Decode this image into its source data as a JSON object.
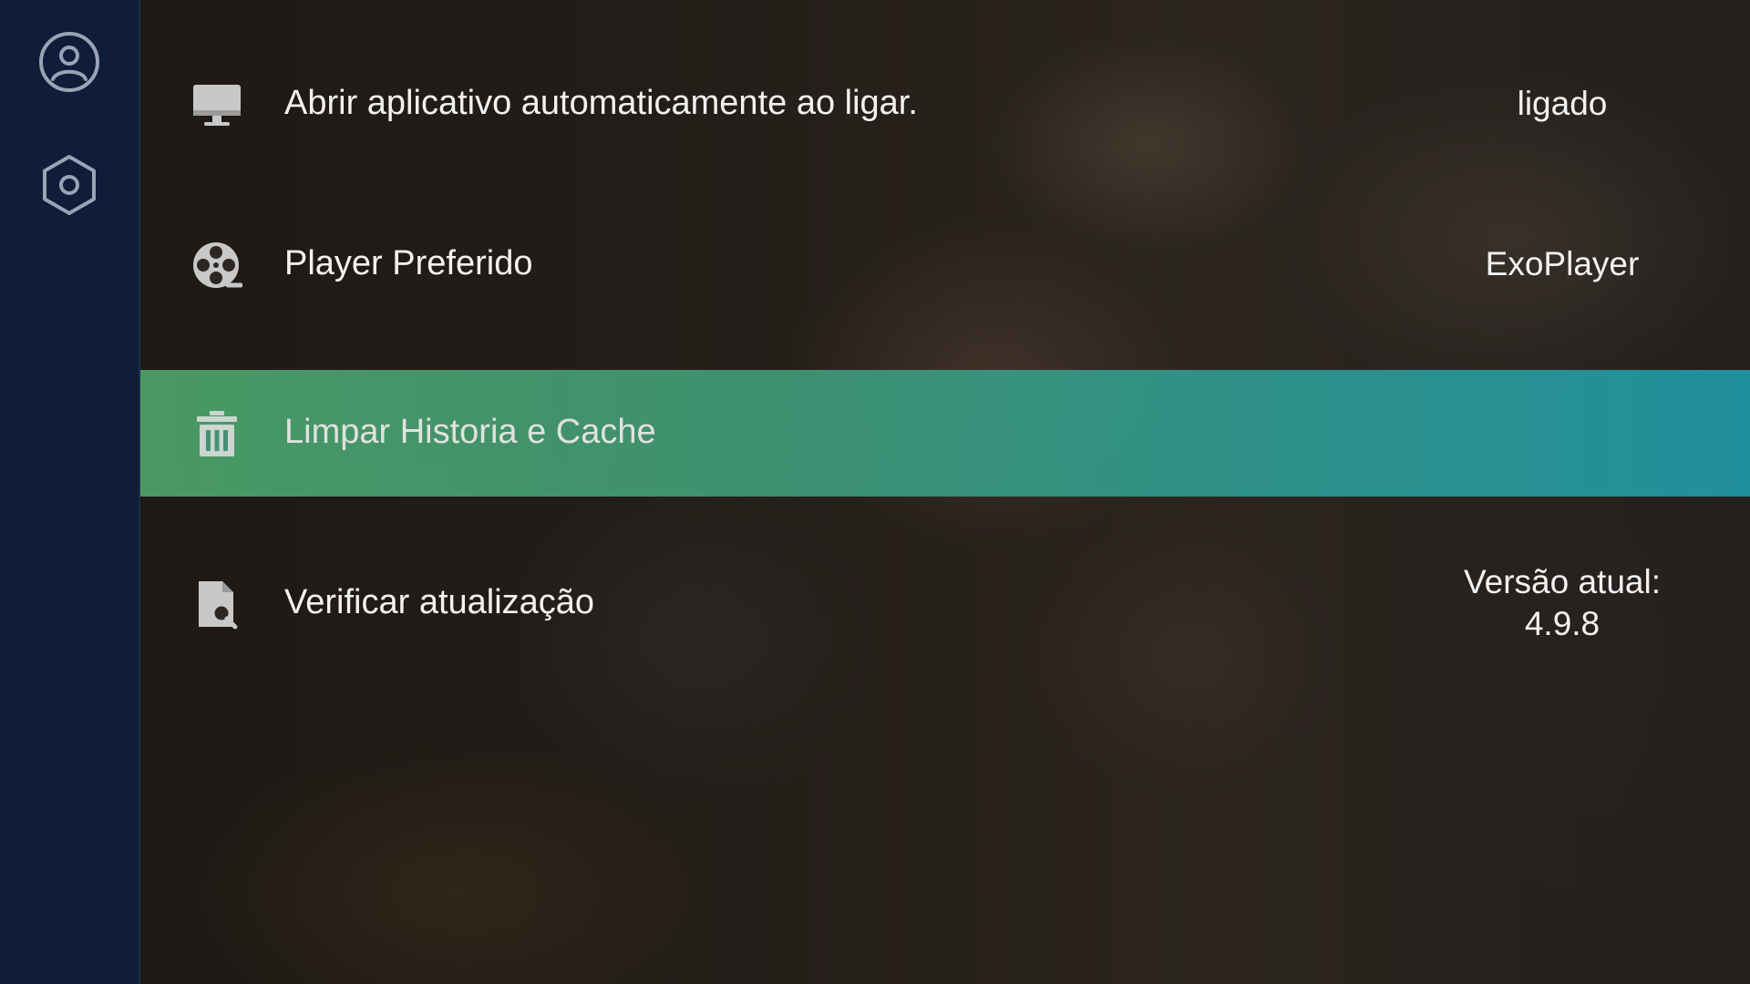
{
  "sidebar": {
    "items": [
      {
        "icon": "user-circle-icon"
      },
      {
        "icon": "settings-hexagon-icon"
      }
    ]
  },
  "settings": [
    {
      "icon": "monitor-icon",
      "label": "Abrir aplicativo automaticamente ao ligar.",
      "value": "ligado"
    },
    {
      "icon": "film-reel-icon",
      "label": "Player Preferido",
      "value": "ExoPlayer"
    },
    {
      "icon": "trash-icon",
      "label": "Limpar Historia e Cache",
      "value": ""
    },
    {
      "icon": "file-search-icon",
      "label": "Verificar atualização",
      "value_line1": "Versão atual:",
      "value_line2": "4.9.8"
    }
  ],
  "colors": {
    "sidebar_bg": "#0f1c3a",
    "highlight_start": "#4ea46a",
    "highlight_end": "#209aa7",
    "icon_gray": "#c8c8c8",
    "sidebar_icon": "#9aa3b5"
  }
}
